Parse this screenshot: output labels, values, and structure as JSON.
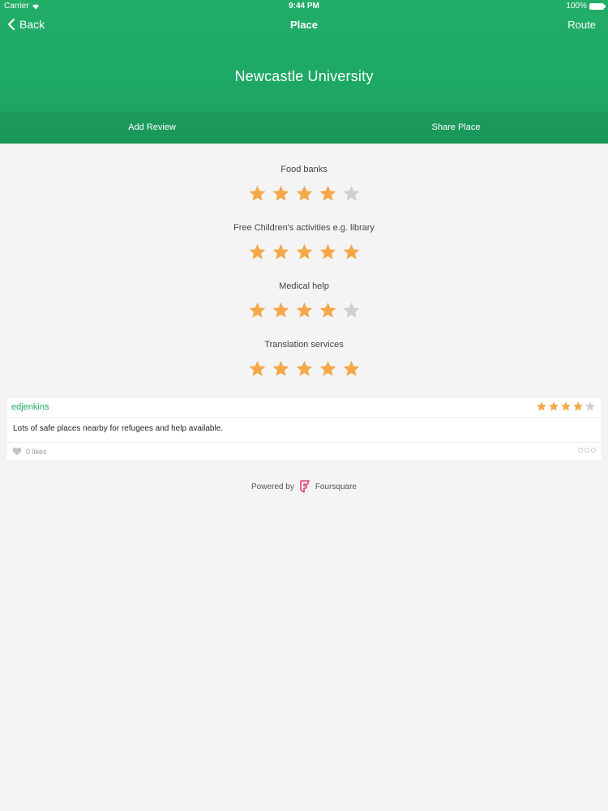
{
  "status_bar": {
    "carrier": "Carrier",
    "time": "9:44 PM",
    "battery": "100%"
  },
  "nav": {
    "back": "Back",
    "title": "Place",
    "route": "Route"
  },
  "place": {
    "name": "Newcastle University"
  },
  "actions": {
    "add_review": "Add Review",
    "share_place": "Share Place"
  },
  "ratings": [
    {
      "label": "Food banks",
      "stars": 4,
      "max": 5
    },
    {
      "label": "Free Children's activities e.g. library",
      "stars": 5,
      "max": 5
    },
    {
      "label": "Medical help",
      "stars": 4,
      "max": 5
    },
    {
      "label": "Translation services",
      "stars": 5,
      "max": 5
    }
  ],
  "review": {
    "user": "edjenkins",
    "stars": 4,
    "max": 5,
    "text": "Lots of safe places nearby for refugees and help available.",
    "likes": "0 likes"
  },
  "footer": {
    "powered_by": "Powered by",
    "brand": "Foursquare"
  },
  "colors": {
    "header_green": "#1ea865",
    "star_filled": "#f5a84a",
    "star_empty": "#cfcfcf",
    "brand_pink": "#e1427a"
  },
  "icons": {
    "back": "chevron-left-icon",
    "star": "star-icon",
    "heart": "heart-icon",
    "more": "more-dots-icon",
    "logo": "foursquare-logo-icon"
  }
}
